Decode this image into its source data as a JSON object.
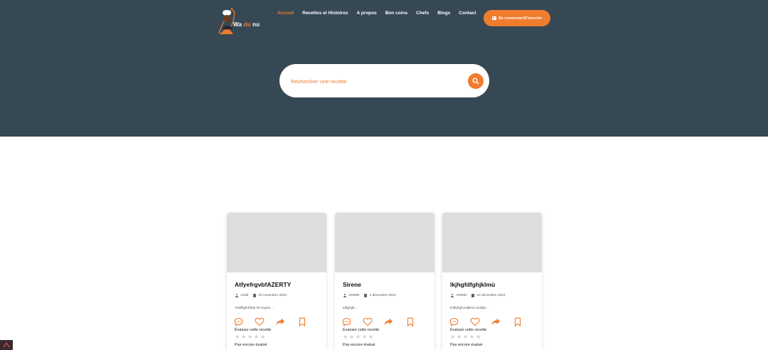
{
  "brand": {
    "name_part1": "Wa",
    "name_part2": "du",
    "name_part3": "nu",
    "accent_color": "#f07c2e",
    "header_bg": "#374855"
  },
  "nav": {
    "items": [
      {
        "label": "Accueil",
        "active": true
      },
      {
        "label": "Recettes et Histoires",
        "active": false
      },
      {
        "label": "A propos",
        "active": false
      },
      {
        "label": "Bon coins",
        "active": false
      },
      {
        "label": "Chefs",
        "active": false
      },
      {
        "label": "Blogs",
        "active": false
      },
      {
        "label": "Contact",
        "active": false
      }
    ],
    "login_label": "Se connecter/S'inscrire",
    "login_icon": "id-card-icon"
  },
  "search": {
    "placeholder": "Rechercher une recette",
    "button_icon": "search-icon"
  },
  "recipes": [
    {
      "title": "AtfyefrgvbfAZERTY",
      "author": "Aedd",
      "date": "23 novembre 2024",
      "description": "Ahdfhjdnfdhjh hh kxgne...",
      "rate_label": "Évaluez cette recette",
      "rating_status": "Pas encore évalué",
      "stars": 0
    },
    {
      "title": "Sirene",
      "author": "ADMIN",
      "date": "4 décembre 2024",
      "description": "sdfghjkl...",
      "rate_label": "Évaluez cette recette",
      "rating_status": "Pas encore évalué",
      "stars": 0
    },
    {
      "title": "lkjhgfdfghjklmù",
      "author": "ADMIN",
      "date": "10 décembre 2024",
      "description": "lmlkjhgfcxnjklmù ùmlkjh...",
      "rate_label": "Évaluez cette recette",
      "rating_status": "Pas encore évalué",
      "stars": 0
    }
  ],
  "card_icons": [
    "comment-icon",
    "heart-icon",
    "share-icon",
    "bookmark-icon"
  ]
}
